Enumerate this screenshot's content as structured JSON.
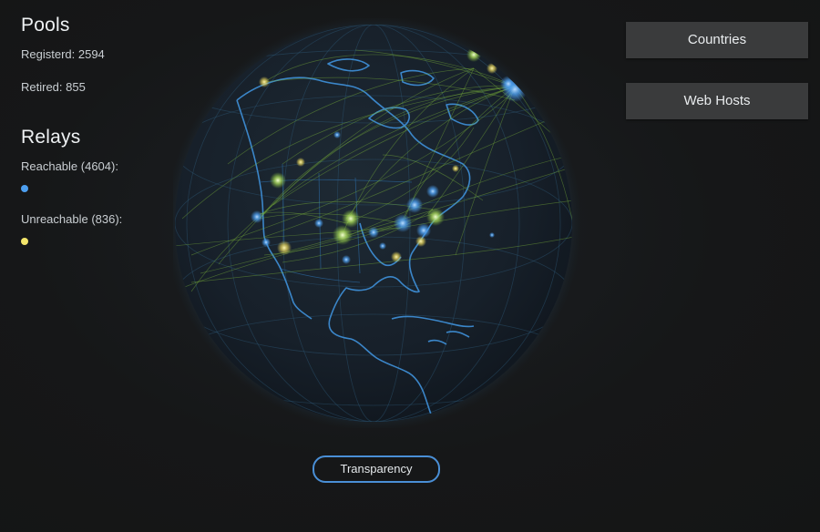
{
  "pools": {
    "title": "Pools",
    "registered": "Registerd: 2594",
    "retired": "Retired: 855"
  },
  "relays": {
    "title": "Relays",
    "reachable_label": "Reachable (4604):",
    "reachable_color": "#4d9ff0",
    "unreachable_label": "Unreachable (836):",
    "unreachable_color": "#f3e56a"
  },
  "buttons": {
    "countries": "Countries",
    "web_hosts": "Web Hosts",
    "transparency": "Transparency"
  },
  "colors": {
    "background": "#161718",
    "button_bg": "#3a3b3c",
    "pill_border": "#4a8fd6",
    "coastline": "#3b86c9",
    "connection_lines": "#7fb83a"
  },
  "globe": {
    "icon": "globe-map-icon"
  }
}
